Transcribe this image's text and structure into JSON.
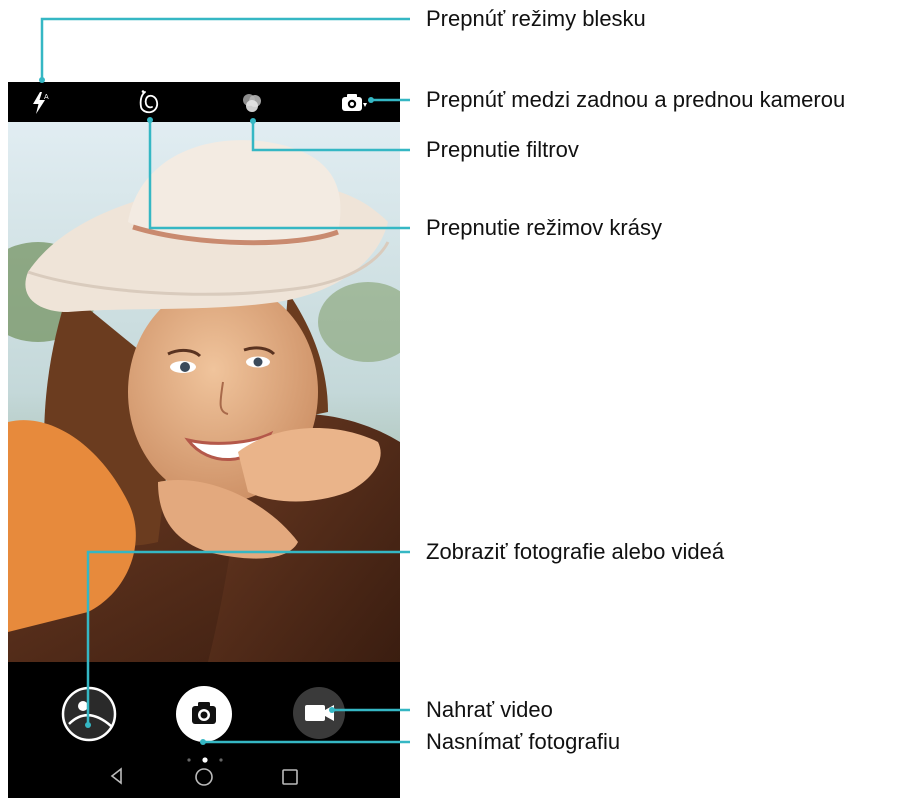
{
  "labels": {
    "flash": "Prepnúť režimy blesku",
    "switch_camera": "Prepnúť medzi zadnou a prednou kamerou",
    "filters": "Prepnutie filtrov",
    "beauty": "Prepnutie režimov krásy",
    "gallery": "Zobraziť fotografie alebo videá",
    "record_video": "Nahrať video",
    "take_photo": "Nasnímať fotografiu"
  },
  "icons": {
    "flash": "flash-icon",
    "beauty": "beauty-mode-icon",
    "filters": "filter-icon",
    "switch_camera": "switch-camera-icon",
    "gallery": "gallery-thumbnail",
    "shutter": "camera-icon",
    "video": "video-camera-icon",
    "nav_back": "back-icon",
    "nav_home": "home-icon",
    "nav_recents": "recents-icon"
  },
  "colors": {
    "callout_line": "#35b7c4",
    "screen_bg": "#000000",
    "shutter_bg": "#ffffff",
    "video_bg": "#3a3a3a"
  },
  "mode_pager": {
    "pages": 3,
    "active": 2
  }
}
